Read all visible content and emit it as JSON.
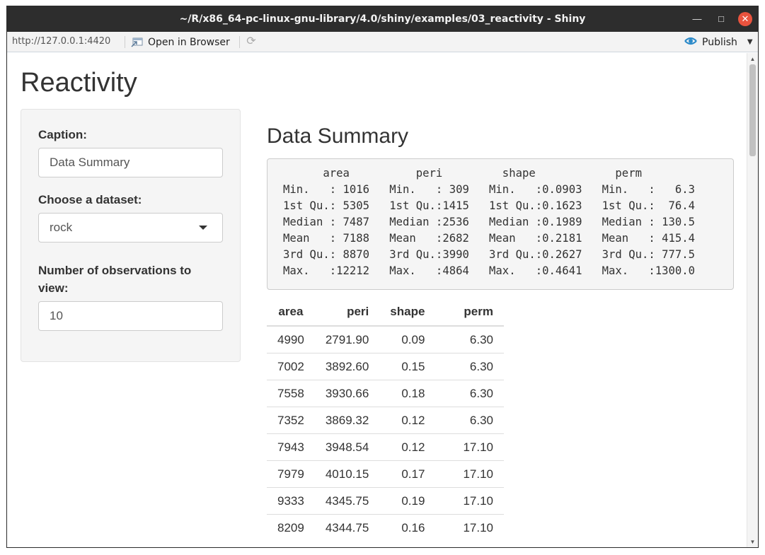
{
  "window": {
    "title": "~/R/x86_64-pc-linux-gnu-library/4.0/shiny/examples/03_reactivity - Shiny",
    "minimize_icon": "minimize-icon",
    "maximize_icon": "maximize-icon",
    "close_icon": "close-icon"
  },
  "toolbar": {
    "url": "http://127.0.0.1:4420",
    "open_in_browser": "Open in Browser",
    "publish": "Publish"
  },
  "app": {
    "title": "Reactivity",
    "sidebar": {
      "caption_label": "Caption:",
      "caption_value": "Data Summary",
      "dataset_label": "Choose a dataset:",
      "dataset_value": "rock",
      "obs_label": "Number of observations to view:",
      "obs_value": "10"
    },
    "main": {
      "summary_title": "Data Summary",
      "summary_lines": [
        "      area          peri         shape            perm",
        "Min.   : 1016   Min.   : 309   Min.   :0.0903   Min.   :   6.3",
        "1st Qu.: 5305   1st Qu.:1415   1st Qu.:0.1623   1st Qu.:  76.4",
        "Median : 7487   Median :2536   Median :0.1989   Median : 130.5",
        "Mean   : 7188   Mean   :2682   Mean   :0.2181   Mean   : 415.4",
        "3rd Qu.: 8870   3rd Qu.:3990   3rd Qu.:0.2627   3rd Qu.: 777.5",
        "Max.   :12212   Max.   :4864   Max.   :0.4641   Max.   :1300.0"
      ],
      "table": {
        "headers": [
          "area",
          "peri",
          "shape",
          "perm"
        ],
        "rows": [
          [
            "4990",
            "2791.90",
            "0.09",
            "6.30"
          ],
          [
            "7002",
            "3892.60",
            "0.15",
            "6.30"
          ],
          [
            "7558",
            "3930.66",
            "0.18",
            "6.30"
          ],
          [
            "7352",
            "3869.32",
            "0.12",
            "6.30"
          ],
          [
            "7943",
            "3948.54",
            "0.12",
            "17.10"
          ],
          [
            "7979",
            "4010.15",
            "0.17",
            "17.10"
          ],
          [
            "9333",
            "4345.75",
            "0.19",
            "17.10"
          ],
          [
            "8209",
            "4344.75",
            "0.16",
            "17.10"
          ]
        ]
      }
    }
  }
}
